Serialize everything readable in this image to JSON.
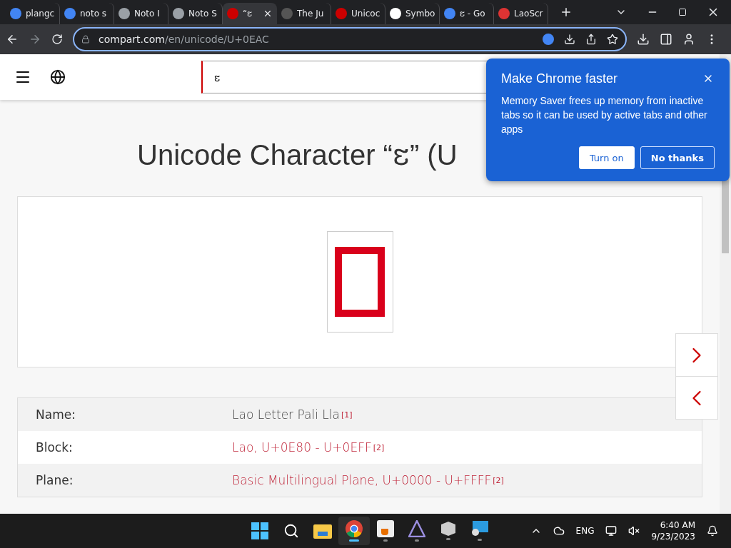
{
  "tabs": [
    {
      "title": "plangc",
      "kind": "google",
      "selected": false
    },
    {
      "title": "noto s",
      "kind": "google",
      "selected": false
    },
    {
      "title": "Noto I",
      "kind": "globe",
      "selected": false
    },
    {
      "title": "Noto S",
      "kind": "globe",
      "selected": false
    },
    {
      "title": "“ຬ",
      "kind": "compart",
      "selected": true
    },
    {
      "title": "The Ju",
      "kind": "julia",
      "selected": false
    },
    {
      "title": "Unicoc",
      "kind": "compart",
      "selected": false
    },
    {
      "title": "Symbo",
      "kind": "wiki",
      "selected": false
    },
    {
      "title": "ຬ - Go",
      "kind": "google",
      "selected": false
    },
    {
      "title": "LaoScr",
      "kind": "lao",
      "selected": false
    }
  ],
  "address_bar": {
    "domain": "compart.com",
    "path": "/en/unicode/U+0EAC"
  },
  "site_header": {
    "search_value": "ຬ"
  },
  "page_title": "Unicode Character “ຬ” (U",
  "properties": [
    {
      "label": "Name:",
      "value": "Lao Letter Pali Lla",
      "ref": "[1]",
      "kind": "text"
    },
    {
      "label": "Block:",
      "value": "Lao, U+0E80 - U+0EFF",
      "ref": "[2]",
      "kind": "link"
    },
    {
      "label": "Plane:",
      "value": "Basic Multilingual Plane, U+0000 - U+FFFF",
      "ref": "[2]",
      "kind": "link"
    }
  ],
  "popup": {
    "title": "Make Chrome faster",
    "body": "Memory Saver frees up memory from inactive tabs so it can be used by active tabs and other apps",
    "buttons": [
      {
        "label": "Turn on",
        "kind": "primary"
      },
      {
        "label": "No thanks",
        "kind": "secondary"
      }
    ]
  },
  "taskbar": {
    "apps": [
      {
        "kind": "start",
        "active": false
      },
      {
        "kind": "search",
        "active": false
      },
      {
        "kind": "files",
        "active": false
      },
      {
        "kind": "chrome",
        "active": true
      },
      {
        "kind": "java",
        "active": false
      },
      {
        "kind": "triangle",
        "active": false
      },
      {
        "kind": "xp",
        "active": false
      },
      {
        "kind": "remote",
        "active": false
      }
    ],
    "language": "ENG",
    "time": "6:40 AM",
    "date": "9/23/2023"
  }
}
